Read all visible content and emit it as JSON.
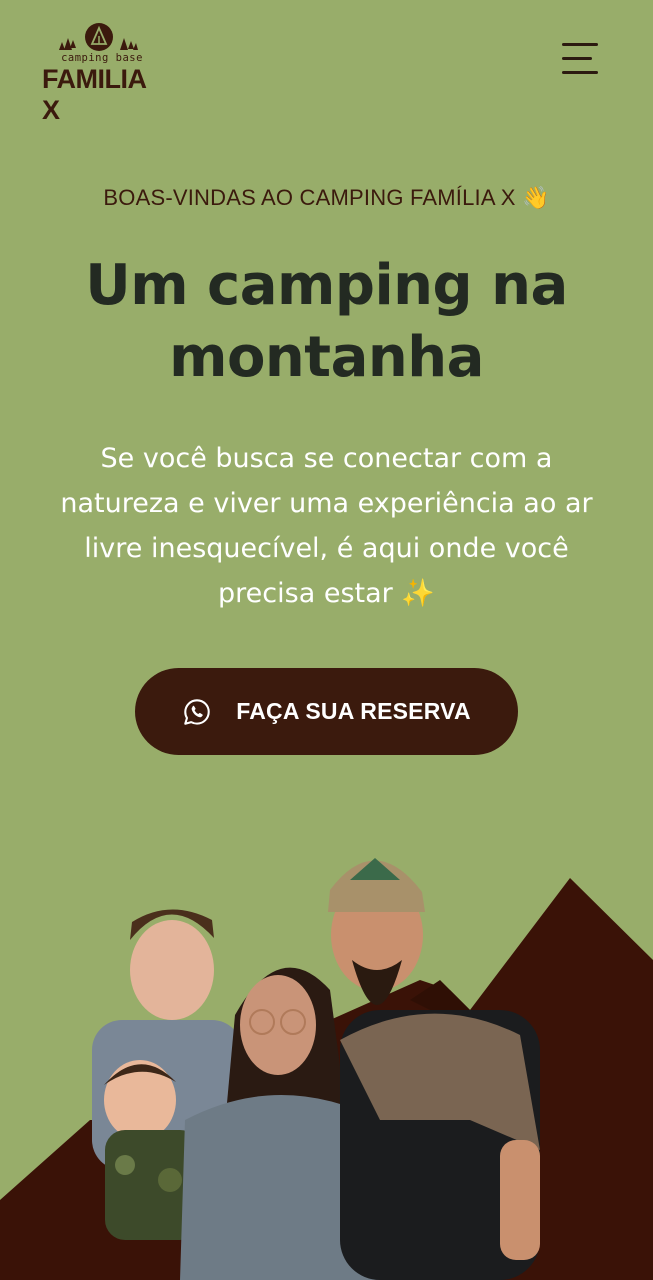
{
  "brand": {
    "subtitle": "camping base",
    "name": "FAMILIA X"
  },
  "header": {
    "menu_icon": "hamburger-menu-icon"
  },
  "hero": {
    "eyebrow": "BOAS-VINDAS AO CAMPING FAMÍLIA X 👋",
    "title_line1": "Um camping na",
    "title_line2": "montanha",
    "description": "Se você busca se conectar com a natureza e viver uma experiência ao ar livre inesquecível, é aqui onde você precisa estar ✨",
    "cta_label": "FAÇA SUA RESERVA",
    "cta_icon": "whatsapp-icon"
  },
  "colors": {
    "background": "#98ad6a",
    "brand_brown": "#3b1a0d",
    "mountain": "#3a1207",
    "title_text": "#232a22",
    "body_text": "#ffffff"
  }
}
